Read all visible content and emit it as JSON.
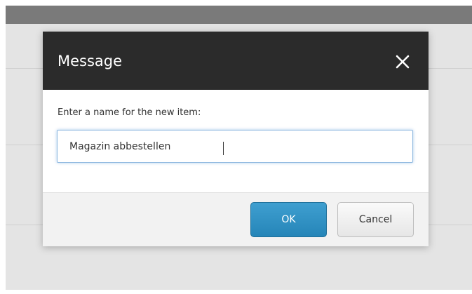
{
  "dialog": {
    "title": "Message",
    "close_icon": "close-icon",
    "prompt": "Enter a name for the new item:",
    "name_input": {
      "value": "Magazin abbestellen"
    },
    "ok_label": "OK",
    "cancel_label": "Cancel"
  },
  "colors": {
    "header_background": "#2b2b2b",
    "ok_button": "#2585b8",
    "input_focus_border": "#8fb8e0",
    "backdrop": "#e4e4e4",
    "top_bar": "#7a7a7a"
  }
}
